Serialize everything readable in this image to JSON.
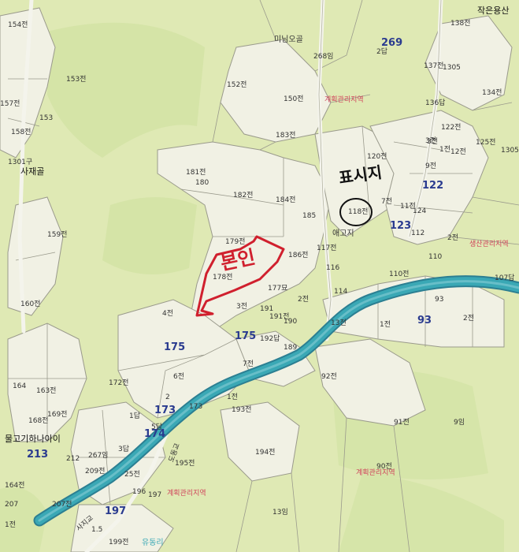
{
  "colors": {
    "land": "#dfe9b4",
    "parcel_fill": "#f1f1e4",
    "parcel_line": "#9a9a8c",
    "road": "#e8e8dc",
    "river": "#3aa8b5",
    "river_edge": "#2c7f92",
    "mark_red": "#d0202e",
    "mark_black": "#111111",
    "number": "#2a3b8f",
    "zone_text": "#d0425a"
  },
  "zones": {
    "top": "계획관리지역",
    "bottom_left": "계획관리지역",
    "bottom_right": "계획관리지역",
    "right": "생산관리지역"
  },
  "places": {
    "top_right": "작은용산",
    "top_center": "미님오골",
    "left_valley": "사재골",
    "left_lower": "물고기하나아이",
    "center_label": "애고지",
    "bottom_road": "사지교",
    "bottom_town": "유동리",
    "road_label": "도동교"
  },
  "annotations": {
    "red_mark": "본인",
    "black_mark": "표시지",
    "circled_parcel": "118전"
  },
  "big_lots": [
    "269",
    "122",
    "123",
    "93",
    "175",
    "175",
    "173",
    "174",
    "213",
    "197"
  ],
  "parcels": [
    "154전",
    "153전",
    "157전",
    "153",
    "158전",
    "1301구",
    "159전",
    "160전",
    "164",
    "163전",
    "168전",
    "169전",
    "212",
    "207전",
    "207",
    "164전",
    "152전",
    "150전",
    "183전",
    "181전",
    "180",
    "182전",
    "184전",
    "185",
    "179전",
    "178전",
    "186전",
    "177묘",
    "191",
    "191전",
    "190",
    "192답",
    "189",
    "4전",
    "3전",
    "6전",
    "7전",
    "2",
    "1답",
    "172전",
    "173",
    "5답",
    "3답",
    "267임",
    "209전",
    "25전",
    "196",
    "197",
    "195전",
    "193전",
    "194전",
    "92전",
    "91전",
    "90전",
    "9임",
    "13임",
    "1전",
    "2전",
    "268임",
    "2답",
    "137전",
    "1305",
    "138전",
    "134전",
    "136답",
    "122전",
    "125전",
    "1305",
    "120전",
    "3전",
    "12전",
    "9전",
    "11전",
    "7전",
    "124",
    "112",
    "117전",
    "116",
    "114",
    "110전",
    "107답",
    "110",
    "93",
    "2전",
    "1전",
    "3전",
    "13전",
    "199전",
    "1.5",
    "1전",
    "2전",
    "1전"
  ]
}
